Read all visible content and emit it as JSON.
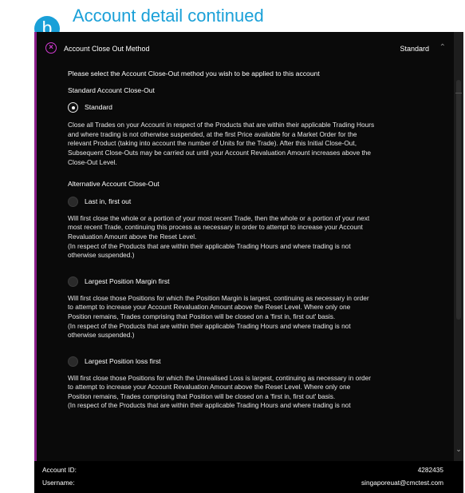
{
  "header": {
    "badge": "b",
    "title": "Account detail continued"
  },
  "section": {
    "title": "Account Close Out Method",
    "selected_value": "Standard"
  },
  "content": {
    "intro": "Please select the Account Close-Out method you wish to be applied to this account",
    "standard_heading": "Standard Account Close-Out",
    "alternative_heading": "Alternative Account Close-Out",
    "options": [
      {
        "label": "Standard",
        "selected": true,
        "lines": [
          "Close all Trades on your Account in respect of the Products that are within their applicable Trading Hours",
          "and where trading is not otherwise suspended, at the first Price available for a Market Order for the",
          "relevant Product (taking into account the number of Units for the Trade). After this Initial Close-Out,",
          "Subsequent Close-Outs may be carried out until your Account Revaluation Amount increases above the",
          "Close-Out Level."
        ]
      },
      {
        "label": "Last in, first out",
        "selected": false,
        "lines": [
          "Will first close the whole or a portion of your most recent Trade, then the whole or a portion of your next",
          "most recent Trade, continuing this process as necessary in order to attempt to increase your Account",
          "Revaluation Amount above the Reset Level.",
          "(In respect of the Products that are within their applicable Trading Hours and where trading is not",
          "otherwise suspended.)"
        ]
      },
      {
        "label": "Largest Position Margin first",
        "selected": false,
        "lines": [
          "Will first close those Positions for which the Position Margin is largest, continuing as necessary in order",
          "to attempt to increase your Account Revaluation Amount above the Reset Level. Where only one",
          "Position remains, Trades comprising that Position will be closed on a 'first in, first out' basis.",
          "(In respect of the Products that are within their applicable Trading Hours and where trading is not",
          "otherwise suspended.)"
        ]
      },
      {
        "label": "Largest Position loss first",
        "selected": false,
        "lines": [
          "Will first close those Positions for which the Unrealised Loss is largest, continuing as necessary in order",
          "to attempt to increase your Account Revaluation Amount above the Reset Level. Where only one",
          "Position remains, Trades comprising that Position will be closed on a 'first in, first out' basis.",
          "(In respect of the Products that are within their applicable Trading Hours and where trading is not"
        ]
      }
    ]
  },
  "footer": {
    "account_id_label": "Account ID:",
    "account_id_value": "4282435",
    "username_label": "Username:",
    "username_value": "singaporeuat@cmctest.com"
  },
  "icons": {
    "close": "close-circle-icon",
    "collapse": "chevron-up-icon",
    "scroll_down": "chevron-down-icon"
  },
  "colors": {
    "accent_blue": "#1aa0d8",
    "accent_magenta": "#d23bd2",
    "panel_bg": "#0a0a0a"
  }
}
